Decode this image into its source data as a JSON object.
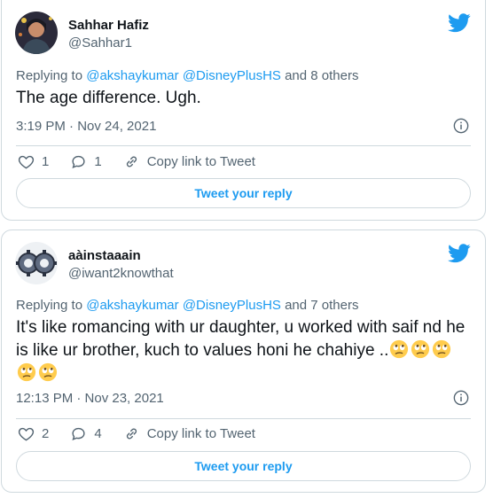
{
  "tweets": [
    {
      "name": "Sahhar Hafiz",
      "handle": "@Sahhar1",
      "replying_prefix": "Replying to ",
      "replying_to": "@akshaykumar @DisneyPlusHS",
      "replying_suffix": " and 8 others",
      "text": "The age difference. Ugh.",
      "timestamp": "3:19 PM · Nov 24, 2021",
      "likes": "1",
      "replies": "1",
      "copy_label": "Copy link to Tweet",
      "reply_button": "Tweet your reply"
    },
    {
      "name": "aàinstaaain",
      "handle": "@iwant2knowthat",
      "replying_prefix": "Replying to ",
      "replying_to": "@akshaykumar @DisneyPlusHS",
      "replying_suffix": " and 7 others",
      "text": "It's like romancing with ur daughter, u worked with saif nd he is like ur brother, kuch to values honi he chahiye ..",
      "emoji_count": 5,
      "emoji_name": "face-with-rolling-eyes",
      "timestamp": "12:13 PM · Nov 23, 2021",
      "likes": "2",
      "replies": "4",
      "copy_label": "Copy link to Tweet",
      "reply_button": "Tweet your reply"
    }
  ],
  "colors": {
    "accent": "#1d9bf0",
    "text": "#0f1419",
    "secondary": "#536471",
    "border": "#cfd9de"
  }
}
